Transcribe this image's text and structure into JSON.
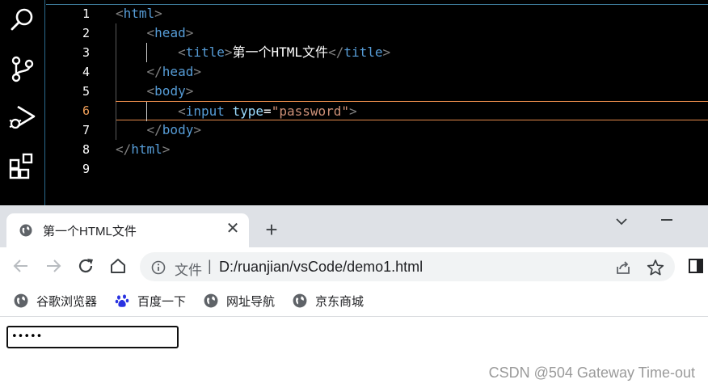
{
  "editor": {
    "line_numbers": [
      "1",
      "2",
      "3",
      "4",
      "5",
      "6",
      "7",
      "8",
      "9"
    ],
    "active_line": "6",
    "lines": [
      {
        "indent": "",
        "parts": [
          [
            "b",
            "<"
          ],
          [
            "t",
            "html"
          ],
          [
            "b",
            ">"
          ]
        ]
      },
      {
        "indent": "    ",
        "parts": [
          [
            "b",
            "<"
          ],
          [
            "t",
            "head"
          ],
          [
            "b",
            ">"
          ]
        ]
      },
      {
        "indent": "        ",
        "parts": [
          [
            "b",
            "<"
          ],
          [
            "t",
            "title"
          ],
          [
            "b",
            ">"
          ],
          [
            "w",
            "第一个HTML文件"
          ],
          [
            "b",
            "</"
          ],
          [
            "t",
            "title"
          ],
          [
            "b",
            ">"
          ]
        ]
      },
      {
        "indent": "    ",
        "parts": [
          [
            "b",
            "</"
          ],
          [
            "t",
            "head"
          ],
          [
            "b",
            ">"
          ]
        ]
      },
      {
        "indent": "    ",
        "parts": [
          [
            "b",
            "<"
          ],
          [
            "t",
            "body"
          ],
          [
            "b",
            ">"
          ]
        ]
      },
      {
        "indent": "        ",
        "parts": [
          [
            "b",
            "<"
          ],
          [
            "t",
            "input"
          ],
          [
            "w",
            " "
          ],
          [
            "a",
            "type"
          ],
          [
            "w",
            "="
          ],
          [
            "s",
            "\"password\""
          ],
          [
            "b",
            ">"
          ]
        ]
      },
      {
        "indent": "    ",
        "parts": [
          [
            "b",
            "</"
          ],
          [
            "t",
            "body"
          ],
          [
            "b",
            ">"
          ]
        ]
      },
      {
        "indent": "",
        "parts": [
          [
            "b",
            "</"
          ],
          [
            "t",
            "html"
          ],
          [
            "b",
            ">"
          ]
        ]
      },
      {
        "indent": "",
        "parts": []
      }
    ]
  },
  "browser": {
    "tab": {
      "title": "第一个HTML文件",
      "favicon": "globe-icon"
    },
    "address": {
      "scheme_label": "文件",
      "separator": "|",
      "url": "D:/ruanjian/vsCode/demo1.html"
    },
    "bookmarks": [
      {
        "label": "谷歌浏览器",
        "icon": "globe-icon"
      },
      {
        "label": "百度一下",
        "icon": "baidu-paw-icon"
      },
      {
        "label": "网址导航",
        "icon": "globe-icon"
      },
      {
        "label": "京东商城",
        "icon": "globe-icon"
      }
    ],
    "page": {
      "password_value": "•••••"
    }
  },
  "watermark": "CSDN @504 Gateway Time-out",
  "colors": {
    "accent_active_line": "#f0a05a",
    "tag": "#569cd6",
    "attr": "#9cdcfe",
    "string": "#ce9178",
    "tabstrip": "#dee1e6"
  }
}
